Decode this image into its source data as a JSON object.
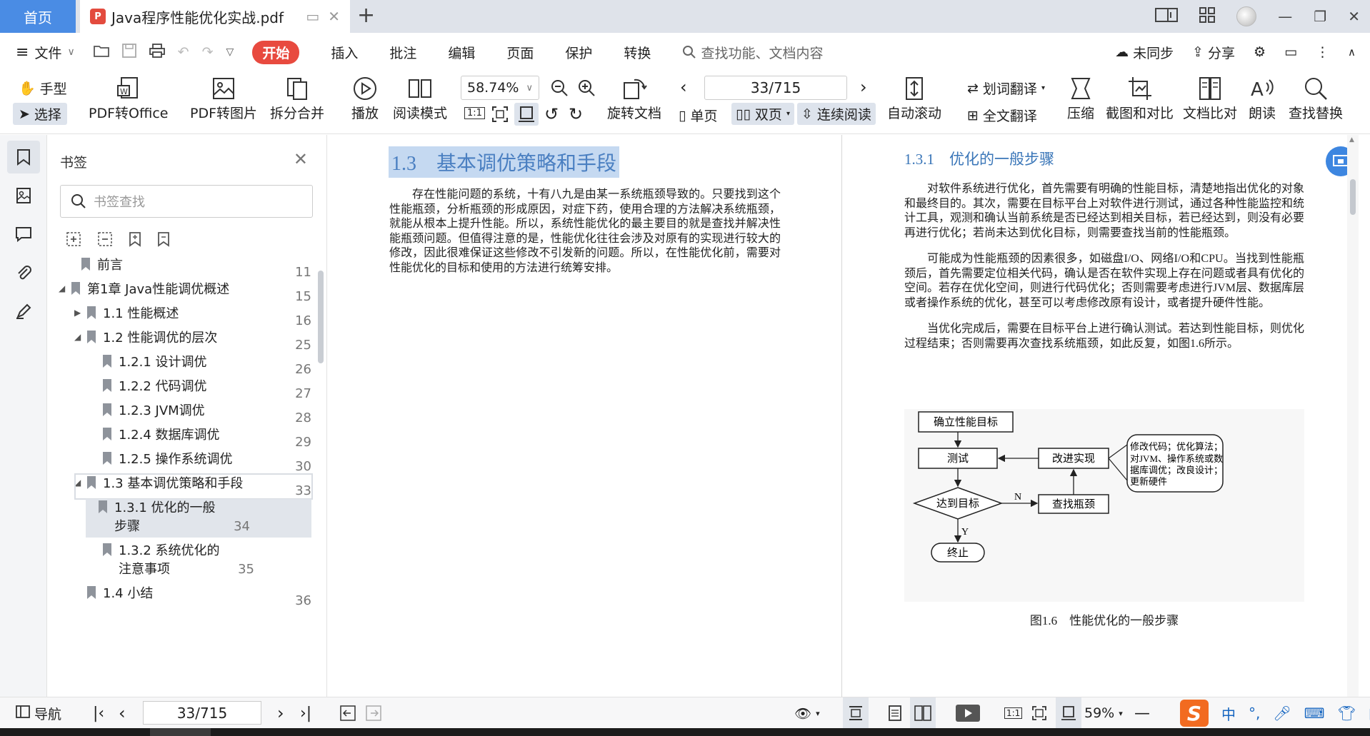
{
  "tabs": {
    "home": "首页",
    "doc_title": "Java程序性能优化实战.pdf",
    "pdf_badge": "P"
  },
  "menu": {
    "file": "文件",
    "items": [
      "开始",
      "插入",
      "批注",
      "编辑",
      "页面",
      "保护",
      "转换"
    ],
    "search_placeholder": "查找功能、文档内容",
    "sync": "未同步",
    "share": "分享"
  },
  "toolbar": {
    "hand": "手型",
    "select": "选择",
    "pdf_to_office": "PDF转Office",
    "pdf_to_image": "PDF转图片",
    "split_merge": "拆分合并",
    "play": "播放",
    "read_mode": "阅读模式",
    "zoom": "58.74%",
    "rotate_doc": "旋转文档",
    "page_indicator": "33/715",
    "single_page": "单页",
    "double_page": "双页",
    "continuous": "连续阅读",
    "auto_scroll": "自动滚动",
    "word_translate": "划词翻译",
    "full_translate": "全文翻译",
    "compress": "压缩",
    "screenshot_compare": "截图和对比",
    "doc_compare": "文档比对",
    "read_aloud": "朗读",
    "find_replace": "查找替换"
  },
  "bookmarks": {
    "title": "书签",
    "search_placeholder": "书签查找",
    "items": [
      {
        "label": "前言",
        "page": "11"
      },
      {
        "label": "第1章 Java性能调优概述",
        "page": "15"
      },
      {
        "label": "1.1 性能概述",
        "page": "16"
      },
      {
        "label": "1.2 性能调优的层次",
        "page": "25"
      },
      {
        "label": "1.2.1 设计调优",
        "page": "26"
      },
      {
        "label": "1.2.2 代码调优",
        "page": "27"
      },
      {
        "label": "1.2.3 JVM调优",
        "page": "28"
      },
      {
        "label": "1.2.4 数据库调优",
        "page": "29"
      },
      {
        "label": "1.2.5 操作系统调优",
        "page": "30"
      },
      {
        "label": "1.3 基本调优策略和手段",
        "page": "33"
      },
      {
        "label": "1.3.1 优化的一般步骤",
        "page": "34"
      },
      {
        "label": "1.3.2 系统优化的注意事项",
        "page": "35"
      },
      {
        "label": "1.4 小结",
        "page": "36"
      }
    ]
  },
  "document": {
    "left_heading": "1.3　基本调优策略和手段",
    "left_para": "存在性能问题的系统，十有八九是由某一系统瓶颈导致的。只要找到这个性能瓶颈，分析瓶颈的形成原因，对症下药，使用合理的方法解决系统瓶颈，就能从根本上提升性能。所以，系统性能优化的最主要目的就是查找并解决性能瓶颈问题。但值得注意的是，性能优化往往会涉及对原有的实现进行较大的修改，因此很难保证这些修改不引发新的问题。所以，在性能优化前，需要对性能优化的目标和使用的方法进行统筹安排。",
    "right_heading": "1.3.1　优化的一般步骤",
    "right_para1": "对软件系统进行优化，首先需要有明确的性能目标，清楚地指出优化的对象和最终目的。其次，需要在目标平台上对软件进行测试，通过各种性能监控和统计工具，观测和确认当前系统是否已经达到相关目标，若已经达到，则没有必要再进行优化；若尚未达到优化目标，则需要查找当前的性能瓶颈。",
    "right_para2": "可能成为性能瓶颈的因素很多，如磁盘I/O、网络I/O和CPU。当找到性能瓶颈后，首先需要定位相关代码，确认是否在软件实现上存在问题或者具有优化的空间。若存在优化空间，则进行代码优化；否则需要考虑进行JVM层、数据库层或者操作系统的优化，甚至可以考虑修改原有设计，或者提升硬件性能。",
    "right_para3": "当优化完成后，需要在目标平台上进行确认测试。若达到性能目标，则优化过程结束；否则需要再次查找系统瓶颈，如此反复，如图1.6所示。",
    "figure": {
      "box_goal": "确立性能目标",
      "box_test": "测试",
      "box_improve": "改进实现",
      "diamond": "达到目标",
      "box_find": "查找瓶颈",
      "terminal": "终止",
      "note_lines": [
        "修改代码；优化算法；",
        "对JVM、操作系统或数",
        "据库调优；改良设计；",
        "更新硬件"
      ],
      "label_n": "N",
      "label_y": "Y",
      "caption": "图1.6　性能优化的一般步骤"
    }
  },
  "statusbar": {
    "nav": "导航",
    "page": "33/715",
    "zoom": "59%"
  },
  "colors": {
    "accent": "#4a8ce4",
    "start_tab": "#e84a3f",
    "heading_highlight": "#c5d9f1"
  }
}
